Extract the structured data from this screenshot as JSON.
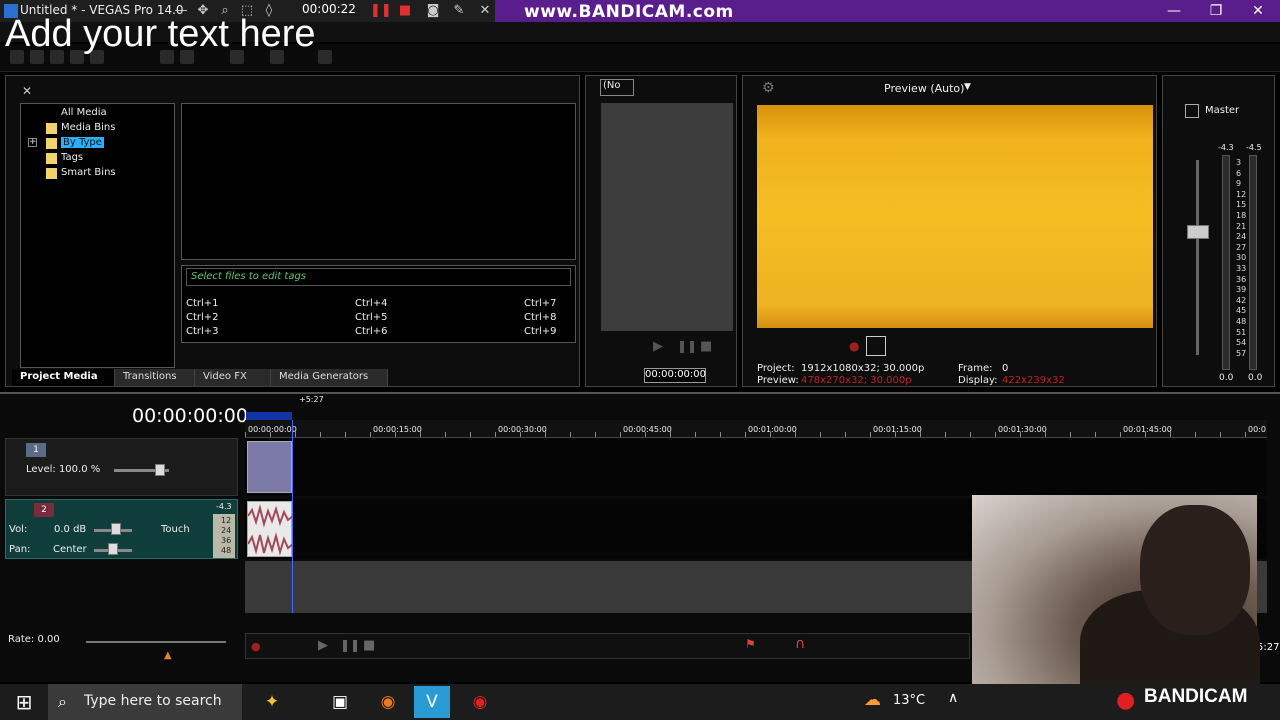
{
  "window": {
    "title": "Untitled * - VEGAS Pro 14.0",
    "rec_time": "00:00:22",
    "bandicam_url": "www.BANDICAM.com",
    "overlay_text": "Add your text here"
  },
  "media_tree": {
    "items": [
      "All Media",
      "Media Bins",
      "By Type",
      "Tags",
      "Smart Bins"
    ],
    "selected": "By Type"
  },
  "tags": {
    "placeholder": "Select files to edit tags",
    "shortcuts": [
      "Ctrl+1",
      "Ctrl+2",
      "Ctrl+3",
      "Ctrl+4",
      "Ctrl+5",
      "Ctrl+6",
      "Ctrl+7",
      "Ctrl+8",
      "Ctrl+9"
    ]
  },
  "tabs": [
    "Project Media",
    "Transitions",
    "Video FX",
    "Media Generators"
  ],
  "trimmer": {
    "select_value": "(No",
    "timecode": "00:00:00:00"
  },
  "preview": {
    "mode": "Preview (Auto)",
    "project_label": "Project:",
    "project_value": "1912x1080x32; 30.000p",
    "preview_label": "Preview:",
    "preview_value": "478x270x32; 30.000p",
    "frame_label": "Frame:",
    "frame_value": "0",
    "display_label": "Display:",
    "display_value": "422x239x32"
  },
  "master": {
    "label": "Master",
    "left_level": "-4.3",
    "right_level": "-4.5",
    "scale": [
      "3",
      "6",
      "9",
      "12",
      "15",
      "18",
      "21",
      "24",
      "27",
      "30",
      "33",
      "36",
      "39",
      "42",
      "45",
      "48",
      "51",
      "54",
      "57"
    ],
    "bottom_left": "0.0",
    "bottom_right": "0.0"
  },
  "timeline": {
    "master_timecode": "00:00:00:00",
    "region_label": "+5:27",
    "ruler": [
      "00:00:00:00",
      "00:00:15:00",
      "00:00:30:00",
      "00:00:45:00",
      "00:01:00:00",
      "00:01:15:00",
      "00:01:30:00",
      "00:01:45:00",
      "00:0"
    ],
    "track1": {
      "number": "1",
      "level_label": "Level: 100.0 %"
    },
    "track2": {
      "number": "2",
      "vol_label": "Vol:",
      "vol_value": "0.0 dB",
      "pan_label": "Pan:",
      "pan_value": "Center",
      "automation": "Touch",
      "meter_top": "-4.3",
      "meter_marks": [
        "12",
        "24",
        "36",
        "48"
      ]
    },
    "rate": "Rate: 0.00",
    "end_time": "5:27"
  },
  "taskbar": {
    "search_placeholder": "Type here to search",
    "temperature": "13°C",
    "bandicam": "BANDICAM"
  }
}
